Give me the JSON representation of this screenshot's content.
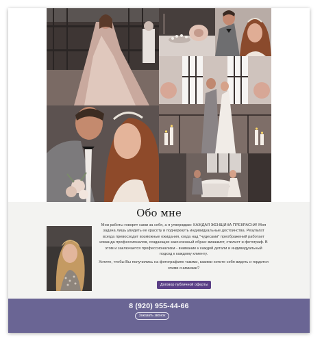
{
  "gallery": {
    "photos": [
      {
        "alt": "bride-with-veil"
      },
      {
        "alt": "wedding-crown-flowers"
      },
      {
        "alt": "couple-portrait"
      },
      {
        "alt": "couple-embrace-closeup"
      },
      {
        "alt": "couple-window-candles"
      },
      {
        "alt": "couple-restaurant-table"
      }
    ]
  },
  "about": {
    "title": "Обо мне",
    "paragraph_1": "Мои работы говорят сами за себя, а я утверждаю: КАЖДАЯ ЖЕНЩИНА ПРЕКРАСНА! Моя задача лишь увидеть ее красоту и подчеркнуть индивидуальные достоинства. Результат всегда превосходит возможные ожидания, когда над \"чудесами\" преображений работает команда профессионалов, создающих законченный образ: визажист, стилист и фотограф. В этом и заключается профессионализм - внимание к каждой детали и индивидуальный подход к каждому клиенту.",
    "paragraph_2": "Хотите, чтобы Вы получились на фотографиях такими, какими хотите себя видеть и гордится этими снимками?",
    "offer_button": "Договор публичной оферты"
  },
  "footer": {
    "phone": "8 (920) 955-44-66",
    "call_button": "Заказать звонок"
  },
  "colors": {
    "accent": "#5a3f86",
    "footer_bg": "#6a6594",
    "section_bg": "#f3f3f1"
  }
}
